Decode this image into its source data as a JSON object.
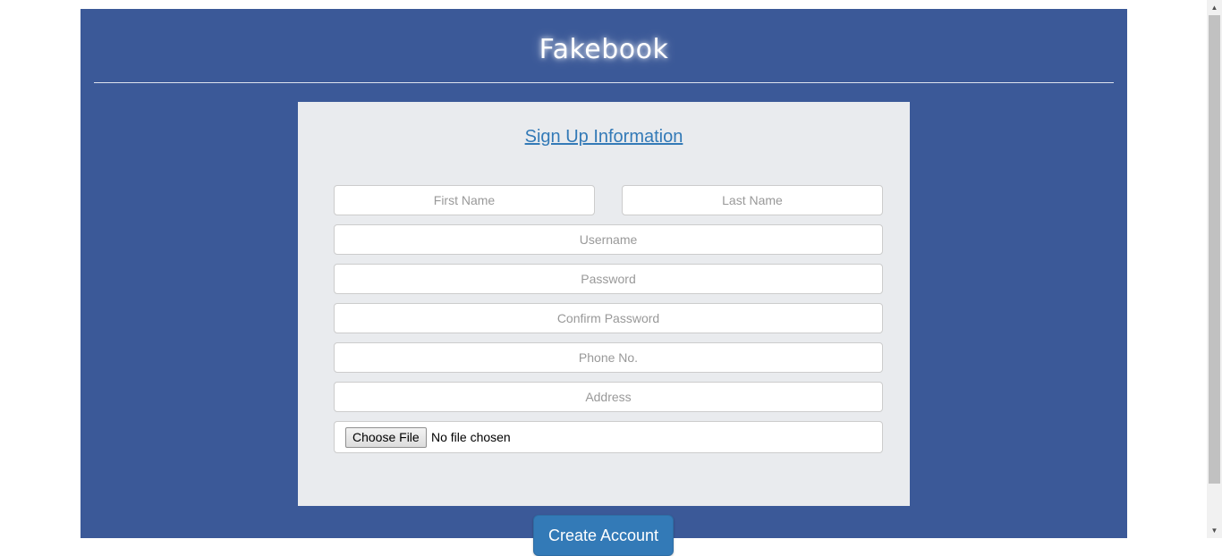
{
  "header": {
    "brand": "Fakebook"
  },
  "form": {
    "title": "Sign Up Information",
    "first_name_placeholder": "First Name",
    "last_name_placeholder": "Last Name",
    "username_placeholder": "Username",
    "password_placeholder": "Password",
    "confirm_password_placeholder": "Confirm Password",
    "phone_placeholder": "Phone No.",
    "address_placeholder": "Address",
    "file_button_label": "Choose File",
    "file_status": "No file chosen",
    "submit_label": "Create Account"
  },
  "icons": {
    "scroll_up": "chevron-up-icon",
    "scroll_down": "chevron-down-icon"
  },
  "colors": {
    "page_background": "#3b5998",
    "card_background": "#e9ebee",
    "accent": "#337ab7"
  }
}
